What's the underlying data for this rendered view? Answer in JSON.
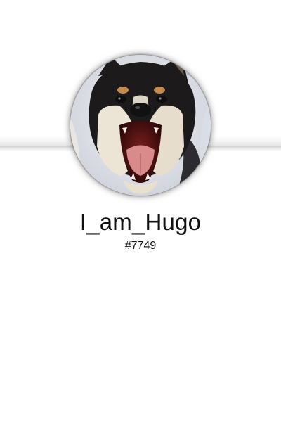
{
  "profile": {
    "username": "I_am_Hugo",
    "discriminator": "#7749",
    "avatar_subject": "shiba-inu-dog-yawning"
  },
  "colors": {
    "background": "#ffffff",
    "text": "#111111",
    "divider": "#d0d0d0"
  }
}
